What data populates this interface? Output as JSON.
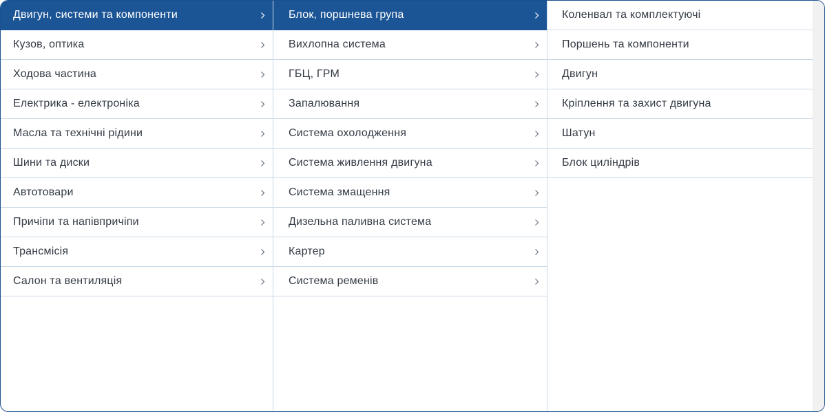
{
  "categories": [
    {
      "label": "Двигун, системи та компоненти",
      "active": true
    },
    {
      "label": "Кузов, оптика"
    },
    {
      "label": "Ходова частина"
    },
    {
      "label": "Електрика - електроніка"
    },
    {
      "label": "Масла та технічні рідини"
    },
    {
      "label": "Шини та диски"
    },
    {
      "label": "Автотовари"
    },
    {
      "label": "Причіпи та напівпричіпи"
    },
    {
      "label": "Трансмісія"
    },
    {
      "label": "Салон та вентиляція"
    }
  ],
  "subcategories": [
    {
      "label": "Блок, поршнева група",
      "active": true
    },
    {
      "label": "Вихлопна система"
    },
    {
      "label": "ГБЦ, ГРМ"
    },
    {
      "label": "Запалювання"
    },
    {
      "label": "Система охолодження"
    },
    {
      "label": "Система живлення двигуна"
    },
    {
      "label": "Система змащення"
    },
    {
      "label": "Дизельна паливна система"
    },
    {
      "label": "Картер"
    },
    {
      "label": "Система ременів"
    }
  ],
  "items": [
    {
      "label": "Коленвал та комплектуючі"
    },
    {
      "label": "Поршень та компоненти"
    },
    {
      "label": "Двигун"
    },
    {
      "label": "Кріплення та захист двигуна"
    },
    {
      "label": "Шатун"
    },
    {
      "label": "Блок циліндрів"
    }
  ],
  "colors": {
    "active_bg": "#1c5596",
    "border": "#1c4f8f",
    "divider": "#c9d8e6"
  },
  "icons": {
    "chevron": "chevron-right-icon"
  }
}
